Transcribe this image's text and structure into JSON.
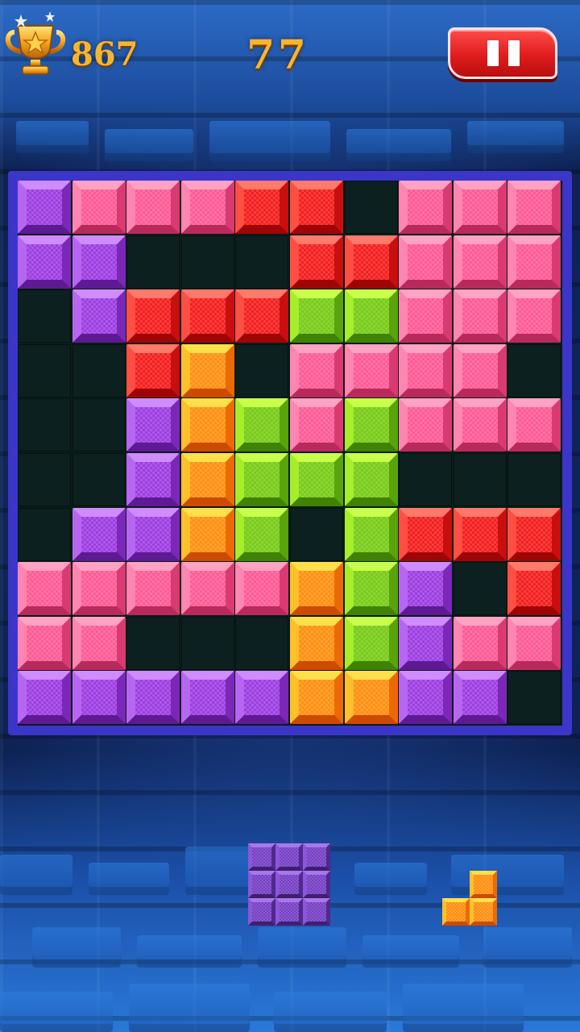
{
  "hud": {
    "best_score": "867",
    "current_score": "77",
    "trophy_icon": "trophy-icon",
    "pause_icon": "pause-icon"
  },
  "colors": {
    "purple": "#a246e6",
    "pink": "#ff5a96",
    "red": "#ff2222",
    "green": "#7fd21c",
    "orange": "#ff9a14",
    "empty": "#0c211f",
    "board_frame": "#3b36c9",
    "score_gold": "#f6b531",
    "pause_red": "#e01d1d"
  },
  "board": {
    "rows": 10,
    "cols": 10,
    "cells": [
      [
        "purple",
        "pink",
        "pink",
        "pink",
        "red",
        "red",
        null,
        "pink",
        "pink",
        "pink"
      ],
      [
        "purple",
        "purple",
        null,
        null,
        null,
        "red",
        "red",
        "pink",
        "pink",
        "pink"
      ],
      [
        null,
        "purple",
        "red",
        "red",
        "red",
        "green",
        "green",
        "pink",
        "pink",
        "pink"
      ],
      [
        null,
        null,
        "red",
        "orange",
        null,
        "pink",
        "pink",
        "pink",
        "pink",
        null
      ],
      [
        null,
        null,
        "purple",
        "orange",
        "green",
        "pink",
        "green",
        "pink",
        "pink",
        "pink"
      ],
      [
        null,
        null,
        "purple",
        "orange",
        "green",
        "green",
        "green",
        null,
        null,
        null
      ],
      [
        null,
        "purple",
        "purple",
        "orange",
        "green",
        null,
        "green",
        "red",
        "red",
        "red"
      ],
      [
        "pink",
        "pink",
        "pink",
        "pink",
        "pink",
        "orange",
        "green",
        "purple",
        null,
        "red"
      ],
      [
        "pink",
        "pink",
        null,
        null,
        null,
        "orange",
        "green",
        "purple",
        "pink",
        "pink"
      ],
      [
        "purple",
        "purple",
        "purple",
        "purple",
        "purple",
        "orange",
        "orange",
        "purple",
        "purple",
        null
      ]
    ]
  },
  "tray": {
    "pieces": [
      {
        "name": "purple-square-3x3",
        "color": "purple",
        "cells": [
          [
            0,
            0
          ],
          [
            1,
            0
          ],
          [
            2,
            0
          ],
          [
            0,
            1
          ],
          [
            1,
            1
          ],
          [
            2,
            1
          ],
          [
            0,
            2
          ],
          [
            1,
            2
          ],
          [
            2,
            2
          ]
        ]
      },
      {
        "name": "orange-corner",
        "color": "orange",
        "cells": [
          [
            1,
            0
          ],
          [
            0,
            1
          ],
          [
            1,
            1
          ]
        ]
      }
    ]
  }
}
